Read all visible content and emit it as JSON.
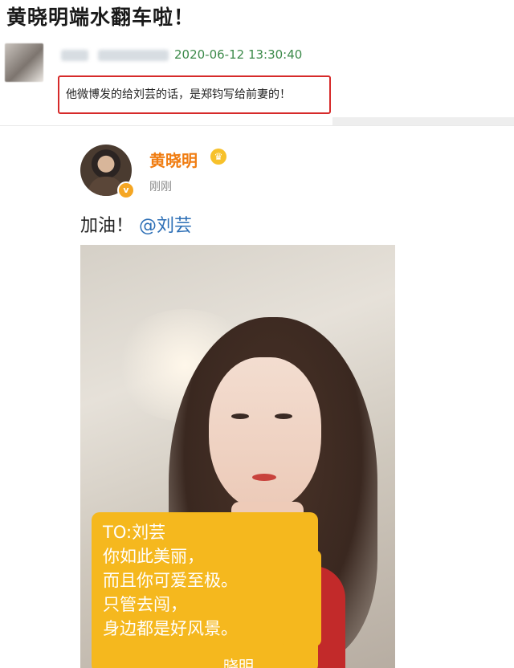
{
  "article": {
    "title": "黄晓明端水翻车啦！"
  },
  "comment": {
    "date": "2020-06-12 13:30:40",
    "highlighted_text": "他微博发的给刘芸的话，是郑钧写给前妻的！"
  },
  "weibo_post": {
    "author": "黄晓明",
    "time": "刚刚",
    "text": "加油！",
    "mention": "@刘芸",
    "verified_badge": "v"
  },
  "photo_note": {
    "lines": [
      "TO:刘芸",
      "你如此美丽，",
      "而且你可爱至极。",
      "只管去闯，",
      "身边都是好风景。"
    ],
    "signature": "晓明"
  },
  "colors": {
    "date_green": "#3c8a4a",
    "highlight_border": "#d62a2a",
    "author_orange": "#f07d12",
    "mention_blue": "#2d6fb6",
    "note_yellow": "#f5b81e"
  }
}
